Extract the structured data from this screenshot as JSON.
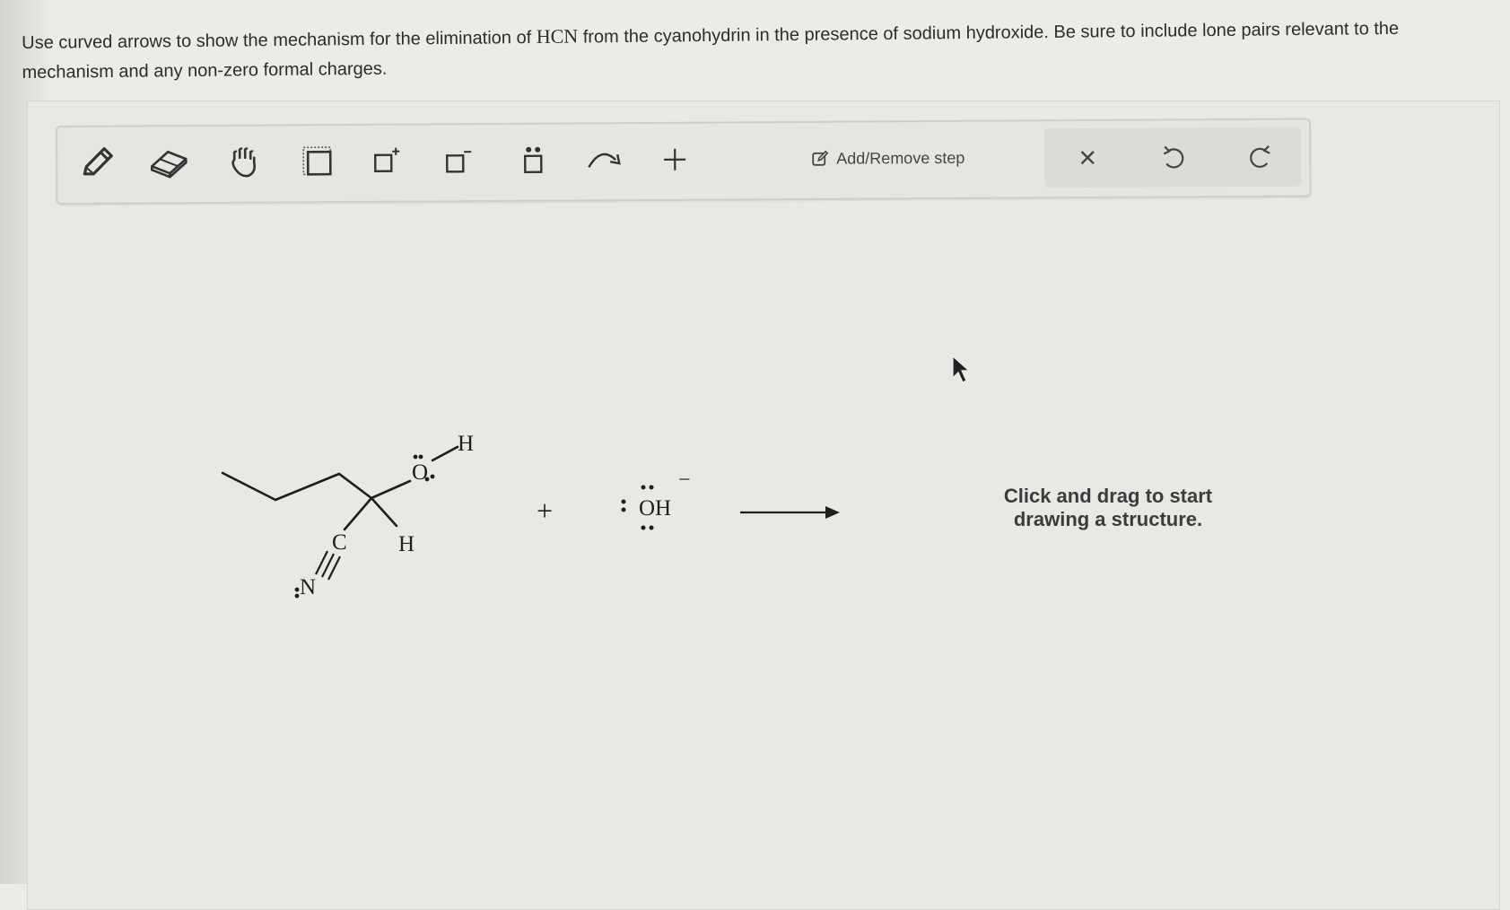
{
  "question": {
    "part1": "Use curved arrows to show the mechanism for the elimination of ",
    "hcn": "HCN",
    "part2": " from the cyanohydrin in the presence of sodium hydroxide. Be sure to include lone pairs relevant to the mechanism and any non-zero formal charges."
  },
  "toolbar": {
    "tools": [
      {
        "name": "pencil-icon",
        "label": "Draw"
      },
      {
        "name": "eraser-icon",
        "label": "Erase"
      },
      {
        "name": "hand-icon",
        "label": "Move"
      },
      {
        "name": "selection-box-icon",
        "label": "Select"
      },
      {
        "name": "positive-charge-icon",
        "label": "Positive charge"
      },
      {
        "name": "negative-charge-icon",
        "label": "Negative charge"
      },
      {
        "name": "lone-pair-icon",
        "label": "Lone pair"
      },
      {
        "name": "curved-arrow-icon",
        "label": "Curved arrow"
      },
      {
        "name": "plus-icon",
        "label": "Add"
      }
    ],
    "add_remove_step": "Add/Remove step",
    "clear_symbol": "×"
  },
  "molecule": {
    "oxygen": "O",
    "hydroxyl_h": "H",
    "alpha_h": "H",
    "carbon": "C",
    "nitrogen": "N",
    "plus": "+",
    "hydroxide": "OH",
    "charge": "−"
  },
  "canvas": {
    "hint_line1": "Click and drag to start",
    "hint_line2": "drawing a structure."
  }
}
